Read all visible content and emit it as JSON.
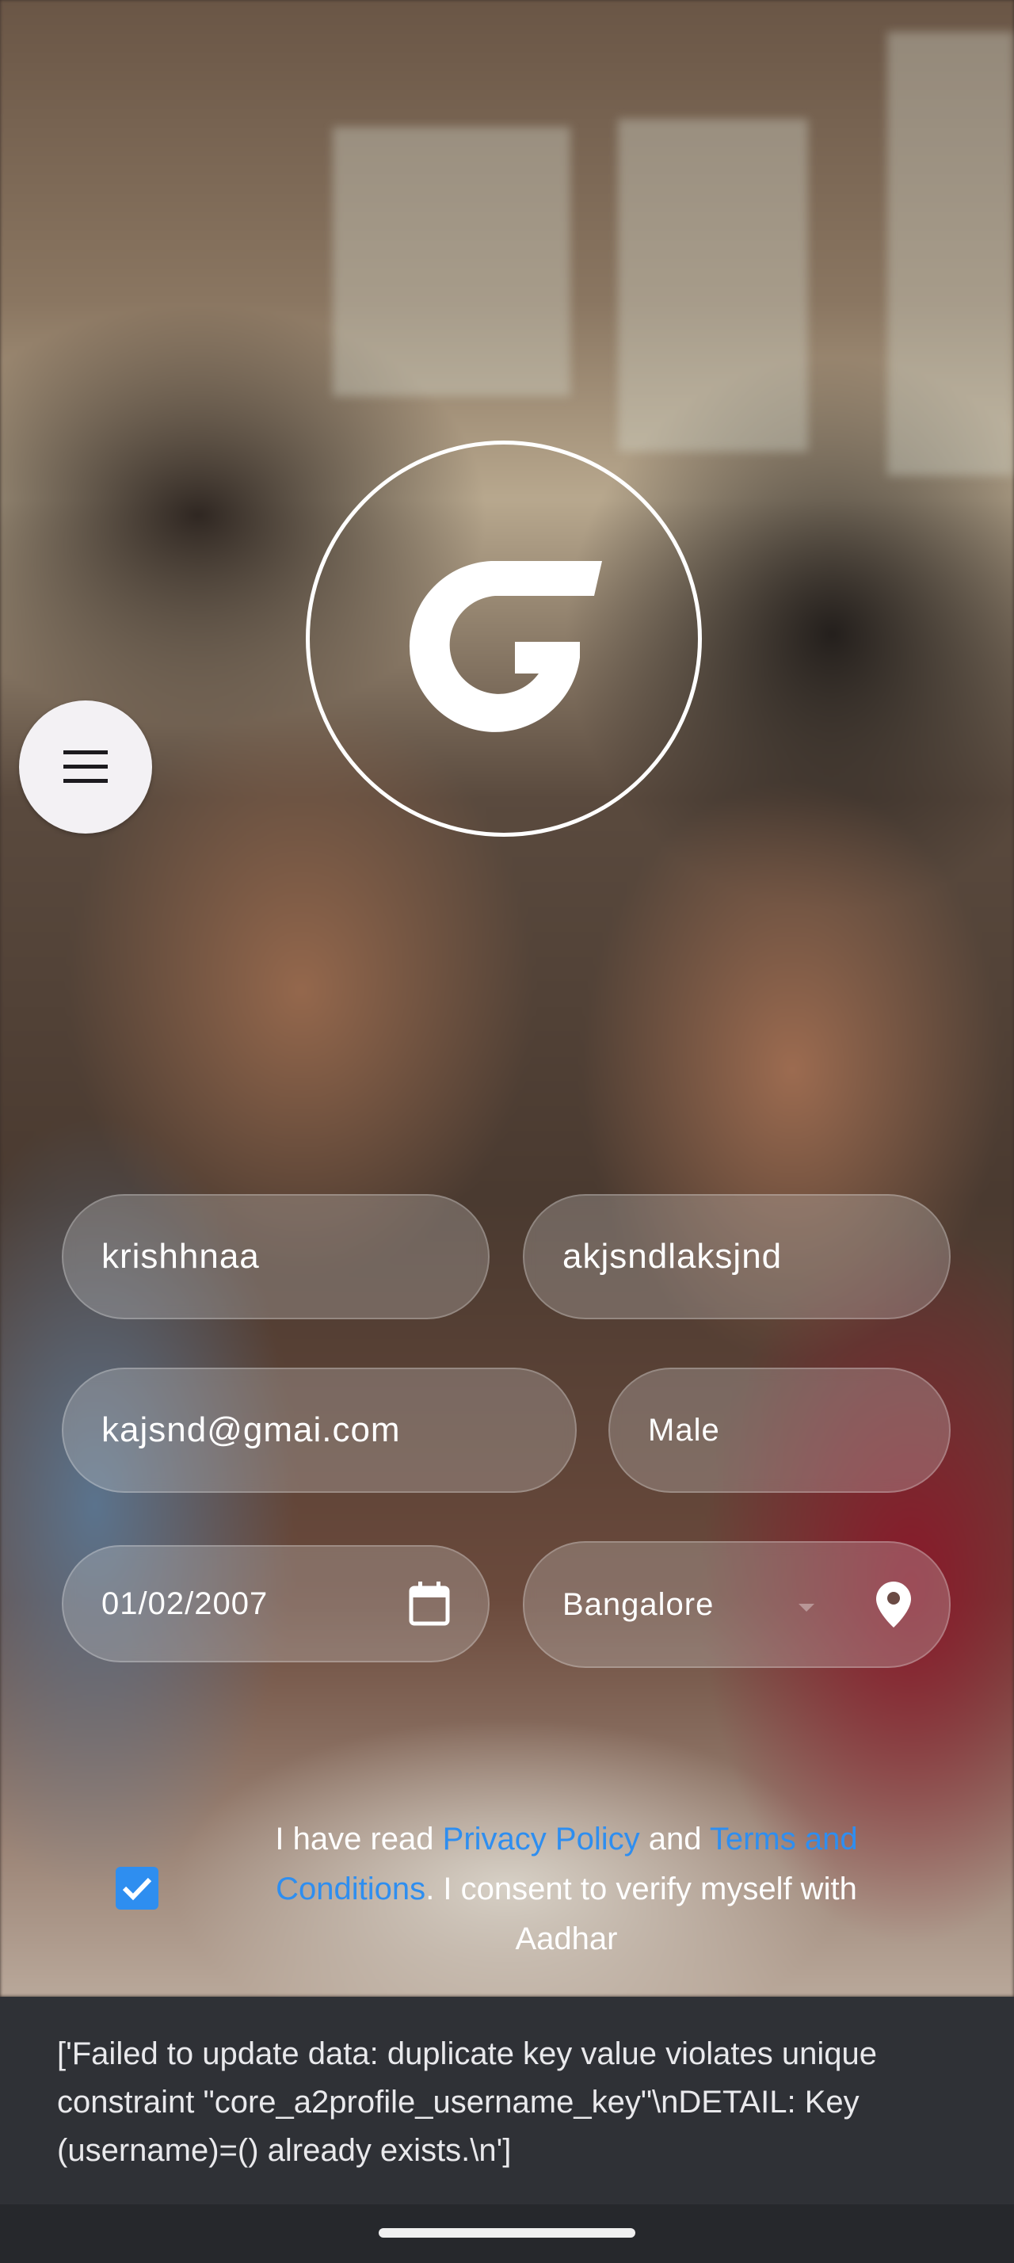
{
  "icons": {
    "menu": "hamburger-menu-icon",
    "logo": "g-logo-icon",
    "calendar": "calendar-icon",
    "location": "location-pin-icon",
    "check": "checkmark-icon",
    "dropdown": "dropdown-caret-icon"
  },
  "form": {
    "first_name": "krishhnaa",
    "last_name": "akjsndlaksjnd",
    "email": "kajsnd@gmai.com",
    "gender": "Male",
    "dob": "01/02/2007",
    "city": "Bangalore"
  },
  "consent": {
    "checked": true,
    "prefix": "I have read ",
    "privacy_link": "Privacy Policy",
    "middle": " and ",
    "terms_link": "Terms and Conditions",
    "suffix": ". I consent to verify myself with Aadhar"
  },
  "snackbar": {
    "message": "['Failed to update data: duplicate key value violates unique constraint \"core_a2profile_username_key\"\\nDETAIL:  Key (username)=() already exists.\\n']"
  },
  "colors": {
    "link": "#2e8ef0",
    "checkbox": "#2e8ef0",
    "snackbar_bg": "#2f3136"
  }
}
